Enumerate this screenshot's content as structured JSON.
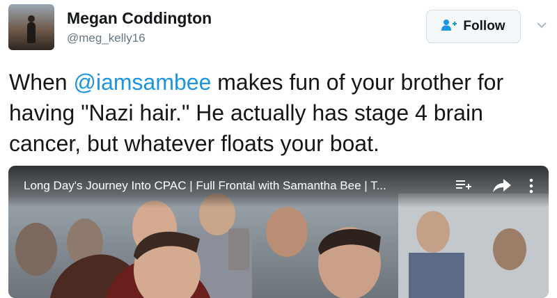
{
  "user": {
    "name": "Megan Coddington",
    "handle": "@meg_kelly16"
  },
  "follow": {
    "label": "Follow",
    "icon": "add-user-icon",
    "accent": "#1b95e0"
  },
  "menu": {
    "icon": "chevron-down-icon"
  },
  "tweet": {
    "text_before": "When ",
    "mention": "@iamsambee",
    "text_after": " makes fun of your brother for having \"Nazi hair.\" He actually has stage 4 brain cancer, but whatever floats your boat.",
    "mention_color": "#1b95e0"
  },
  "video": {
    "title": "Long Day's Journey Into CPAC | Full Frontal with Samantha Bee | T...",
    "controls": [
      "queue-icon",
      "share-icon",
      "more-icon"
    ]
  }
}
